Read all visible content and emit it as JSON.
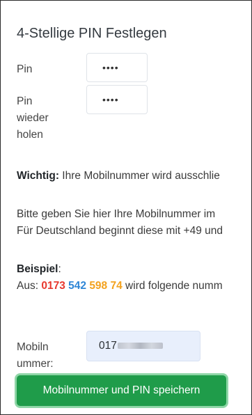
{
  "form": {
    "title": "4-Stellige PIN Festlegen",
    "pin_label": "Pin",
    "pin_value": "••••",
    "pin_repeat_label_lines": [
      "Pin",
      "wieder",
      "holen"
    ],
    "pin_repeat_value": "••••"
  },
  "notice": {
    "important_label": "Wichtig:",
    "important_text": " Ihre Mobilnummer wird ausschlie",
    "instruction_line1": "Bitte geben Sie hier Ihre Mobilnummer im",
    "instruction_line2": "Für Deutschland beginnt diese mit +49 und"
  },
  "example": {
    "label": "Beispiel",
    "colon": ":",
    "prefix": "Aus: ",
    "part1": "0173",
    "part2": "542",
    "part3": "598",
    "part4": "74",
    "suffix": " wird folgende numm"
  },
  "mobile": {
    "label_lines": [
      "Mobiln",
      "ummer:"
    ],
    "value_visible": "017"
  },
  "actions": {
    "save_label": "Mobilnummer und PIN speichern"
  },
  "colors": {
    "button_bg": "#1f9c4a",
    "button_focus_ring": "#8fd6a7",
    "highlight_red": "#e8392f",
    "highlight_blue": "#2f86d6",
    "highlight_orange": "#f3a21e",
    "input_autofill_bg": "#e8effc"
  }
}
